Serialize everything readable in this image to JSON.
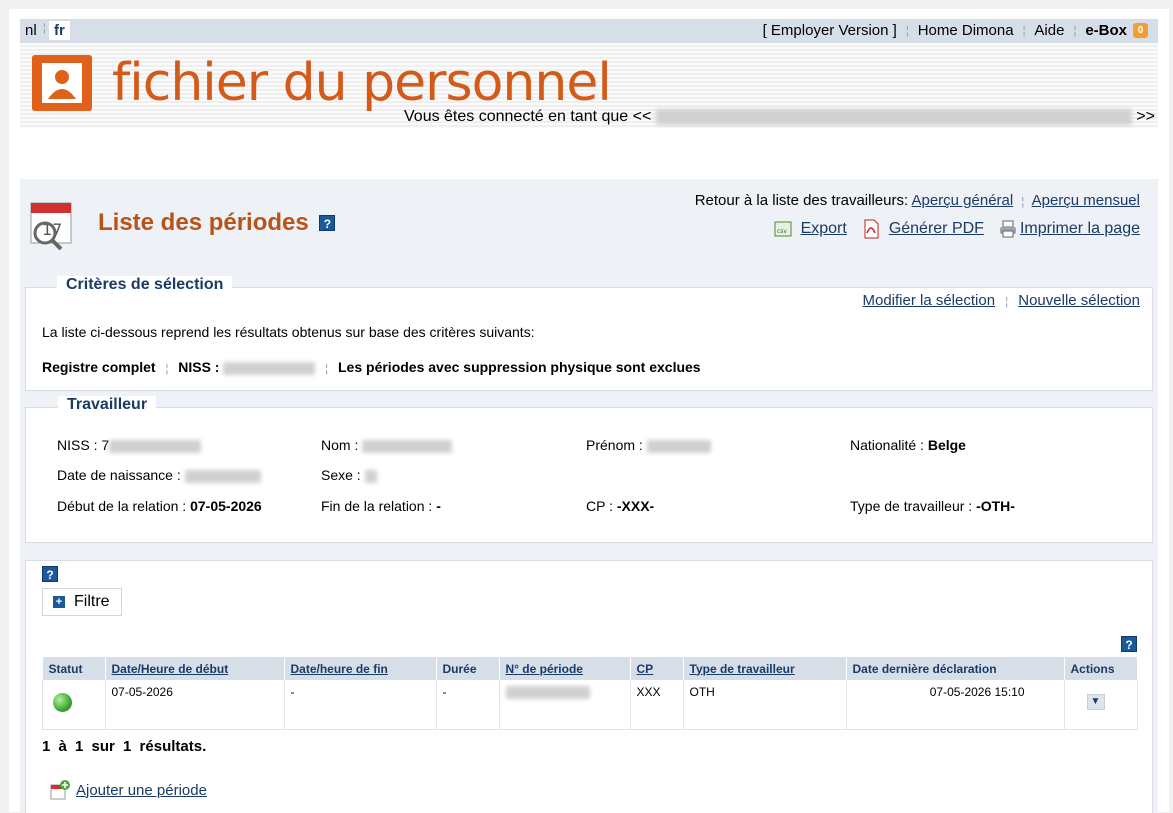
{
  "topbar": {
    "lang_nl": "nl",
    "lang_fr": "fr",
    "employer_version": "[ Employer Version ]",
    "home_dimona": "Home Dimona",
    "aide": "Aide",
    "ebox": "e-Box",
    "ebox_badge": "0"
  },
  "banner": {
    "logo_text": "fichier du personnel",
    "connected_prefix": "Vous êtes connecté en tant que <<",
    "connected_suffix": ">>"
  },
  "header": {
    "title": "Liste des périodes",
    "help": "?",
    "retour_label": "Retour à la liste des travailleurs:",
    "apercu_general": "Aperçu général",
    "apercu_mensuel": "Aperçu mensuel",
    "export": "Export",
    "generer_pdf": "Générer PDF",
    "imprimer": "Imprimer la page"
  },
  "criteres": {
    "legend": "Critères de sélection",
    "modifier": "Modifier la sélection",
    "nouvelle": "Nouvelle sélection",
    "description": "La liste ci-dessous reprend les résultats obtenus sur base des critères suivants:",
    "registre": "Registre complet",
    "niss_label": "NISS :",
    "exclusion": "Les périodes avec suppression physique sont exclues"
  },
  "travailleur": {
    "legend": "Travailleur",
    "niss_label": "NISS :",
    "niss_visible": "7",
    "nom_label": "Nom :",
    "prenom_label": "Prénom :",
    "nationalite_label": "Nationalité :",
    "nationalite": "Belge",
    "naissance_label": "Date de naissance :",
    "sexe_label": "Sexe :",
    "debut_label": "Début de la relation :",
    "debut": "07-05-2026",
    "fin_label": "Fin de la relation :",
    "fin": "-",
    "cp_label": "CP :",
    "cp": "-XXX-",
    "type_label": "Type de travailleur :",
    "type": "-OTH-"
  },
  "liste": {
    "help": "?",
    "filtre": "Filtre",
    "columns": [
      "Statut",
      "Date/Heure de début",
      "Date/heure de fin",
      "Durée",
      "N° de période",
      "CP",
      "Type de travailleur",
      "Date dernière déclaration",
      "Actions"
    ],
    "rows": [
      {
        "debut": "07-05-2026",
        "fin": "-",
        "duree": "-",
        "cp": "XXX",
        "type": "OTH",
        "derniere": "07-05-2026 15:10"
      }
    ],
    "results": "1 à 1 sur 1 résultats.",
    "ajouter": "Ajouter une période"
  },
  "colors": {
    "accent": "#b8541a",
    "link": "#1a3b66",
    "header_bg": "#d6dee8",
    "status_ok": "#3aa830"
  }
}
